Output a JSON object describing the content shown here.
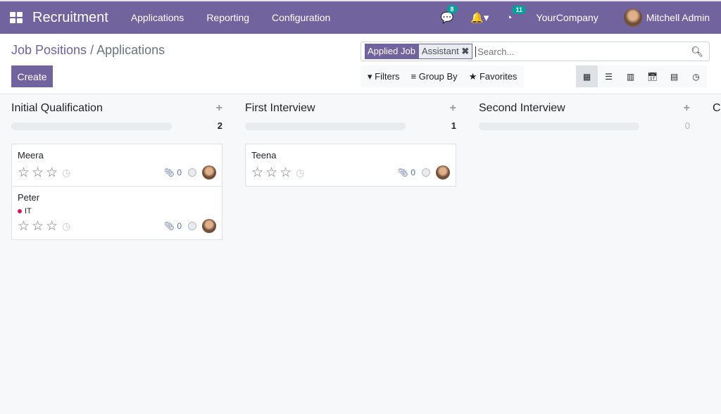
{
  "navbar": {
    "app_name": "Recruitment",
    "menus": [
      "Applications",
      "Reporting",
      "Configuration"
    ],
    "messages_count": "8",
    "activities_count": "11",
    "company": "YourCompany",
    "user": "Mitchell Admin"
  },
  "breadcrumb": {
    "parent": "Job Positions",
    "separator": "/",
    "current": "Applications"
  },
  "create_label": "Create",
  "search": {
    "facet_label": "Applied Job",
    "facet_value": "Assistant",
    "placeholder": "Search..."
  },
  "filters": {
    "filters": "Filters",
    "group_by": "Group By",
    "favorites": "Favorites"
  },
  "views": [
    "kanban",
    "list",
    "graph",
    "calendar",
    "pivot",
    "activity"
  ],
  "columns": [
    {
      "title": "Initial Qualification",
      "count": "2",
      "cards": [
        {
          "name": "Meera",
          "tags": [],
          "attachments": "0"
        },
        {
          "name": "Peter",
          "tags": [
            "IT"
          ],
          "attachments": "0"
        }
      ]
    },
    {
      "title": "First Interview",
      "count": "1",
      "cards": [
        {
          "name": "Teena",
          "tags": [],
          "attachments": "0"
        }
      ]
    },
    {
      "title": "Second Interview",
      "count": "0",
      "cards": []
    },
    {
      "title": "C",
      "count": "",
      "cards": []
    }
  ]
}
